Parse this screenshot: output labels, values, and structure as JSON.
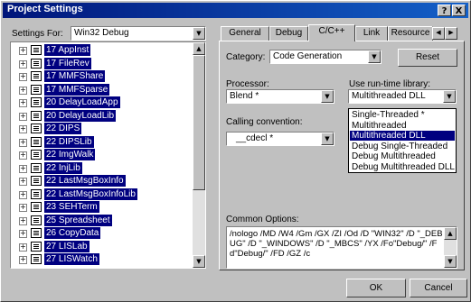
{
  "window": {
    "title": "Project Settings"
  },
  "settings_for": {
    "label": "Settings For:",
    "value": "Win32 Debug"
  },
  "tree_items": [
    "17 AppInst",
    "17 FileRev",
    "17 MMFShare",
    "17 MMFSparse",
    "20 DelayLoadApp",
    "20 DelayLoadLib",
    "22 DIPS",
    "22 DIPSLib",
    "22 ImgWalk",
    "22 InjLib",
    "22 LastMsgBoxInfo",
    "22 LastMsgBoxInfoLib",
    "23 SEHTerm",
    "25 Spreadsheet",
    "26 CopyData",
    "27 LISLab",
    "27 LISWatch"
  ],
  "tabs": [
    "General",
    "Debug",
    "C/C++",
    "Link",
    "Resource"
  ],
  "active_tab": "C/C++",
  "category": {
    "label": "Category:",
    "value": "Code Generation",
    "reset_label": "Reset"
  },
  "processor": {
    "label": "Processor:",
    "value": "Blend *"
  },
  "calling_convention": {
    "label": "Calling convention:",
    "value": "__cdecl *"
  },
  "runtime_library": {
    "label": "Use run-time library:",
    "value": "Multithreaded DLL",
    "options": [
      "Single-Threaded *",
      "Multithreaded",
      "Multithreaded DLL",
      "Debug Single-Threaded",
      "Debug Multithreaded",
      "Debug Multithreaded DLL"
    ],
    "selected_index": 2
  },
  "common_options": {
    "label": "Common Options:",
    "text": "/nologo /MD /W4 /Gm /GX /ZI /Od /D \"WIN32\" /D \"_DEBUG\" /D \"_WINDOWS\" /D \"_MBCS\" /YX /Fo\"Debug/\" /Fd\"Debug/\" /FD /GZ /c"
  },
  "buttons": {
    "ok": "OK",
    "cancel": "Cancel"
  },
  "caption_buttons": {
    "help": "?",
    "close": "X"
  }
}
